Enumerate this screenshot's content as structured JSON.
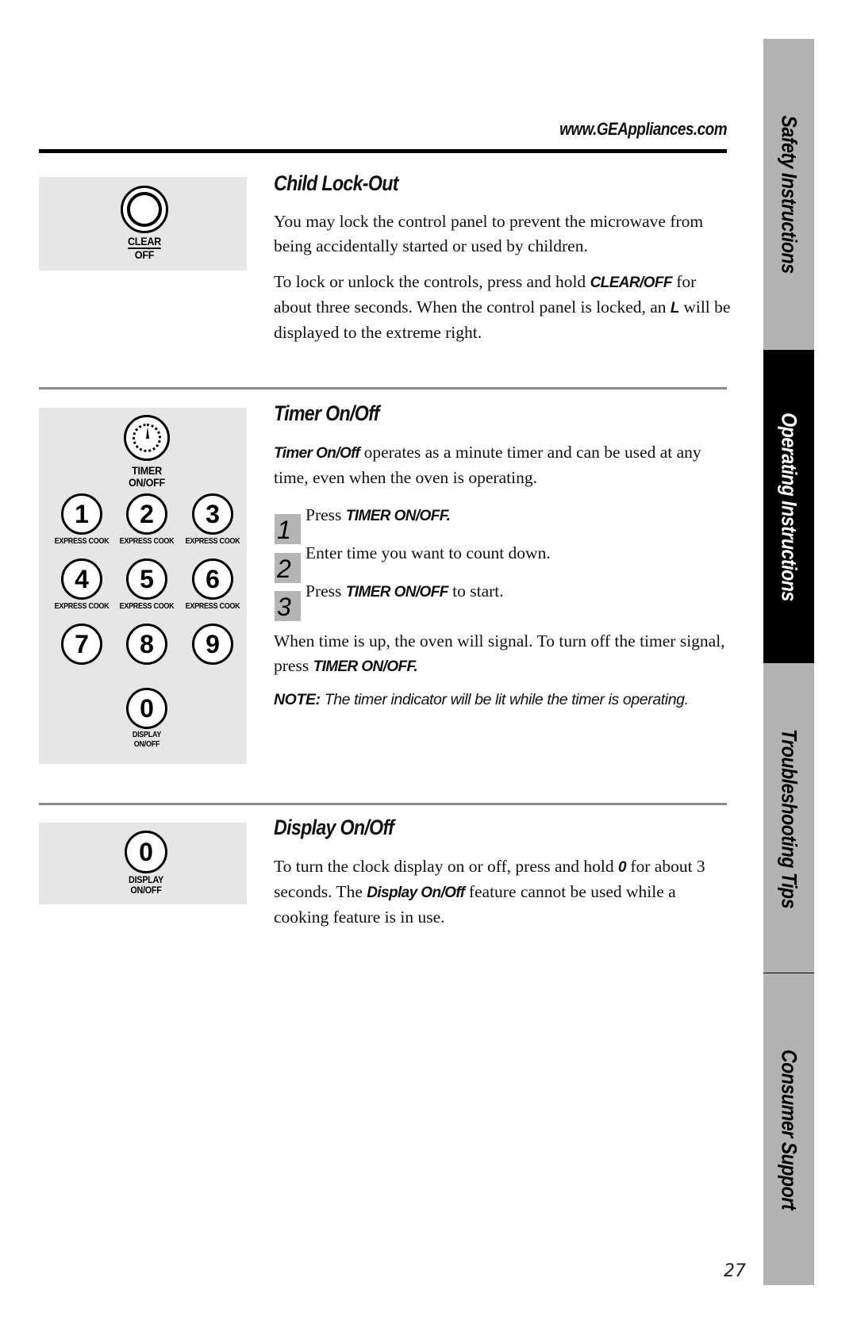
{
  "header": {
    "url": "www.GEAppliances.com"
  },
  "sections": {
    "child_lock": {
      "title": "Child Lock-Out",
      "para1": "You may lock the control panel to prevent the microwave from being accidentally started or used by children.",
      "para2_a": "To lock or unlock the controls, press and hold ",
      "para2_b": "CLEAR/OFF",
      "para2_c": " for about three seconds. When the control panel is locked, an ",
      "para2_d": "L",
      "para2_e": " will be displayed to the extreme right.",
      "button": {
        "line1": "CLEAR",
        "line2": "OFF"
      }
    },
    "timer": {
      "title": "Timer On/Off",
      "intro_a": "Timer On/Off",
      "intro_b": " operates as a minute timer and can be used at any time, even when the oven is operating.",
      "steps": [
        {
          "num": "1",
          "text_a": "Press ",
          "text_b": "TIMER ON/OFF.",
          "text_c": ""
        },
        {
          "num": "2",
          "text_a": "Enter time you want to count down.",
          "text_b": "",
          "text_c": ""
        },
        {
          "num": "3",
          "text_a": "Press ",
          "text_b": "TIMER ON/OFF",
          "text_c": " to start."
        }
      ],
      "after_a": "When time is up, the oven will signal. To turn off the timer signal, press ",
      "after_b": "TIMER ON/OFF.",
      "note_label": "NOTE:",
      "note_text": " The timer indicator will be lit while the timer is operating.",
      "keypad": {
        "timer_label_1": "TIMER",
        "timer_label_2": "ON/OFF",
        "keys": [
          "1",
          "2",
          "3",
          "4",
          "5",
          "6",
          "7",
          "8",
          "9",
          "0"
        ],
        "express_label": "EXPRESS COOK",
        "zero_label_1": "DISPLAY",
        "zero_label_2": "ON/OFF"
      }
    },
    "display": {
      "title": "Display On/Off",
      "para_a": "To turn the clock display on or off, press and hold ",
      "para_b": "0",
      "para_c": " for about 3 seconds. The ",
      "para_d": "Display On/Off",
      "para_e": " feature cannot be used while a cooking feature is in use.",
      "button": {
        "key": "0",
        "line1": "DISPLAY",
        "line2": "ON/OFF"
      }
    }
  },
  "side_tabs": [
    {
      "label": "Safety Instructions",
      "active": false
    },
    {
      "label": "Operating Instructions",
      "active": true
    },
    {
      "label": "Troubleshooting Tips",
      "active": false
    },
    {
      "label": "Consumer Support",
      "active": false
    }
  ],
  "colors": {
    "tab_inactive": "#b3b3b3",
    "tab_active": "#000000",
    "panel_bg": "#e6e6e6",
    "step_box": "#b4b4b4"
  },
  "page_number": "27"
}
